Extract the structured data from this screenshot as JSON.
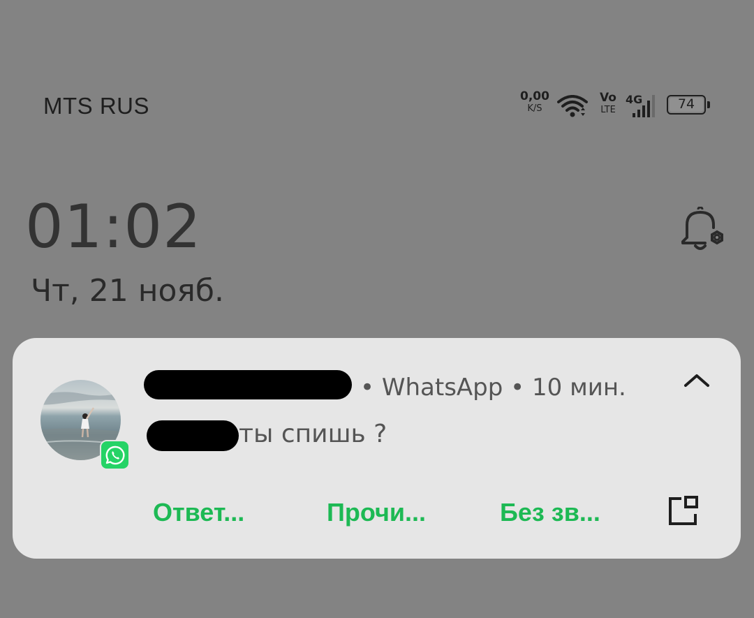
{
  "status_bar": {
    "carrier": "MTS RUS",
    "net_speed_value": "0,00",
    "net_speed_unit": "K/S",
    "volte_top": "Vo",
    "volte_bottom": "LTE",
    "network_type": "4G",
    "battery_level": "74",
    "icons": [
      "wifi-icon",
      "volte-icon",
      "signal-icon",
      "battery-icon"
    ]
  },
  "lock_screen": {
    "time": "01:02",
    "date": "Чт, 21 нояб.",
    "bell_icon": "bell-settings-icon"
  },
  "notification": {
    "app_name": "WhatsApp",
    "meta": "• WhatsApp • 10 мин.",
    "message_visible_text": "ты спишь ?",
    "actions": {
      "reply": "Ответ...",
      "read": "Прочи...",
      "mute": "Без зв..."
    },
    "colors": {
      "card_background": "#e6e6e6",
      "action_color": "#1db954",
      "whatsapp_badge": "#25d366",
      "screen_background": "#838383"
    }
  }
}
